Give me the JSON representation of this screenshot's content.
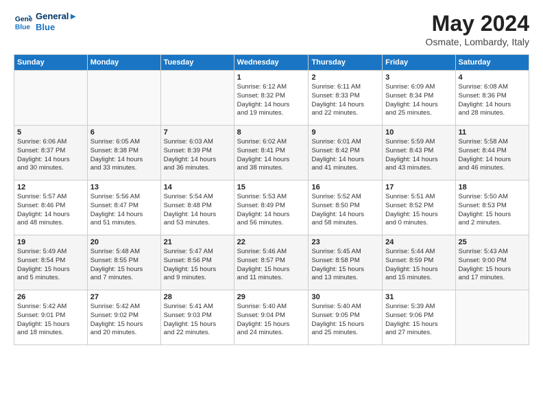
{
  "header": {
    "logo_line1": "General",
    "logo_line2": "Blue",
    "month_year": "May 2024",
    "location": "Osmate, Lombardy, Italy"
  },
  "weekdays": [
    "Sunday",
    "Monday",
    "Tuesday",
    "Wednesday",
    "Thursday",
    "Friday",
    "Saturday"
  ],
  "weeks": [
    [
      {
        "day": "",
        "info": ""
      },
      {
        "day": "",
        "info": ""
      },
      {
        "day": "",
        "info": ""
      },
      {
        "day": "1",
        "info": "Sunrise: 6:12 AM\nSunset: 8:32 PM\nDaylight: 14 hours\nand 19 minutes."
      },
      {
        "day": "2",
        "info": "Sunrise: 6:11 AM\nSunset: 8:33 PM\nDaylight: 14 hours\nand 22 minutes."
      },
      {
        "day": "3",
        "info": "Sunrise: 6:09 AM\nSunset: 8:34 PM\nDaylight: 14 hours\nand 25 minutes."
      },
      {
        "day": "4",
        "info": "Sunrise: 6:08 AM\nSunset: 8:36 PM\nDaylight: 14 hours\nand 28 minutes."
      }
    ],
    [
      {
        "day": "5",
        "info": "Sunrise: 6:06 AM\nSunset: 8:37 PM\nDaylight: 14 hours\nand 30 minutes."
      },
      {
        "day": "6",
        "info": "Sunrise: 6:05 AM\nSunset: 8:38 PM\nDaylight: 14 hours\nand 33 minutes."
      },
      {
        "day": "7",
        "info": "Sunrise: 6:03 AM\nSunset: 8:39 PM\nDaylight: 14 hours\nand 36 minutes."
      },
      {
        "day": "8",
        "info": "Sunrise: 6:02 AM\nSunset: 8:41 PM\nDaylight: 14 hours\nand 38 minutes."
      },
      {
        "day": "9",
        "info": "Sunrise: 6:01 AM\nSunset: 8:42 PM\nDaylight: 14 hours\nand 41 minutes."
      },
      {
        "day": "10",
        "info": "Sunrise: 5:59 AM\nSunset: 8:43 PM\nDaylight: 14 hours\nand 43 minutes."
      },
      {
        "day": "11",
        "info": "Sunrise: 5:58 AM\nSunset: 8:44 PM\nDaylight: 14 hours\nand 46 minutes."
      }
    ],
    [
      {
        "day": "12",
        "info": "Sunrise: 5:57 AM\nSunset: 8:46 PM\nDaylight: 14 hours\nand 48 minutes."
      },
      {
        "day": "13",
        "info": "Sunrise: 5:56 AM\nSunset: 8:47 PM\nDaylight: 14 hours\nand 51 minutes."
      },
      {
        "day": "14",
        "info": "Sunrise: 5:54 AM\nSunset: 8:48 PM\nDaylight: 14 hours\nand 53 minutes."
      },
      {
        "day": "15",
        "info": "Sunrise: 5:53 AM\nSunset: 8:49 PM\nDaylight: 14 hours\nand 56 minutes."
      },
      {
        "day": "16",
        "info": "Sunrise: 5:52 AM\nSunset: 8:50 PM\nDaylight: 14 hours\nand 58 minutes."
      },
      {
        "day": "17",
        "info": "Sunrise: 5:51 AM\nSunset: 8:52 PM\nDaylight: 15 hours\nand 0 minutes."
      },
      {
        "day": "18",
        "info": "Sunrise: 5:50 AM\nSunset: 8:53 PM\nDaylight: 15 hours\nand 2 minutes."
      }
    ],
    [
      {
        "day": "19",
        "info": "Sunrise: 5:49 AM\nSunset: 8:54 PM\nDaylight: 15 hours\nand 5 minutes."
      },
      {
        "day": "20",
        "info": "Sunrise: 5:48 AM\nSunset: 8:55 PM\nDaylight: 15 hours\nand 7 minutes."
      },
      {
        "day": "21",
        "info": "Sunrise: 5:47 AM\nSunset: 8:56 PM\nDaylight: 15 hours\nand 9 minutes."
      },
      {
        "day": "22",
        "info": "Sunrise: 5:46 AM\nSunset: 8:57 PM\nDaylight: 15 hours\nand 11 minutes."
      },
      {
        "day": "23",
        "info": "Sunrise: 5:45 AM\nSunset: 8:58 PM\nDaylight: 15 hours\nand 13 minutes."
      },
      {
        "day": "24",
        "info": "Sunrise: 5:44 AM\nSunset: 8:59 PM\nDaylight: 15 hours\nand 15 minutes."
      },
      {
        "day": "25",
        "info": "Sunrise: 5:43 AM\nSunset: 9:00 PM\nDaylight: 15 hours\nand 17 minutes."
      }
    ],
    [
      {
        "day": "26",
        "info": "Sunrise: 5:42 AM\nSunset: 9:01 PM\nDaylight: 15 hours\nand 18 minutes."
      },
      {
        "day": "27",
        "info": "Sunrise: 5:42 AM\nSunset: 9:02 PM\nDaylight: 15 hours\nand 20 minutes."
      },
      {
        "day": "28",
        "info": "Sunrise: 5:41 AM\nSunset: 9:03 PM\nDaylight: 15 hours\nand 22 minutes."
      },
      {
        "day": "29",
        "info": "Sunrise: 5:40 AM\nSunset: 9:04 PM\nDaylight: 15 hours\nand 24 minutes."
      },
      {
        "day": "30",
        "info": "Sunrise: 5:40 AM\nSunset: 9:05 PM\nDaylight: 15 hours\nand 25 minutes."
      },
      {
        "day": "31",
        "info": "Sunrise: 5:39 AM\nSunset: 9:06 PM\nDaylight: 15 hours\nand 27 minutes."
      },
      {
        "day": "",
        "info": ""
      }
    ]
  ]
}
